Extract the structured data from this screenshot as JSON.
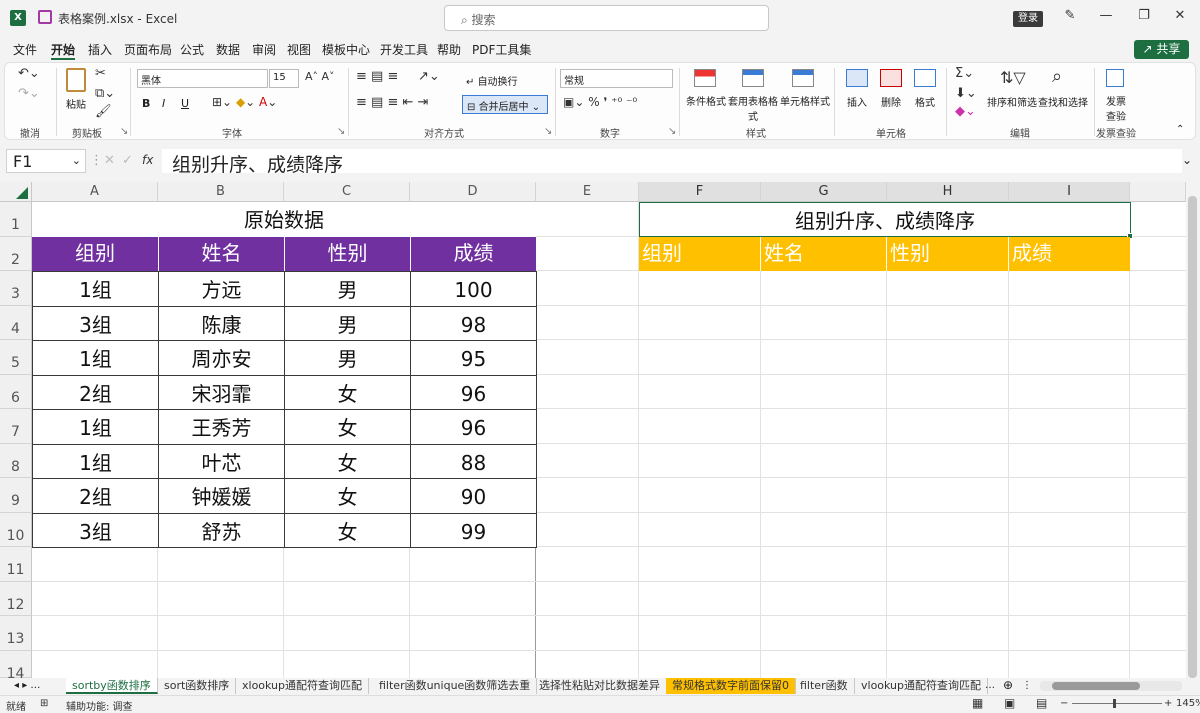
{
  "titlebar": {
    "filename": "表格案例.xlsx",
    "app": "Excel",
    "title": "表格案例.xlsx - Excel",
    "search_placeholder": "搜索",
    "login": "登录"
  },
  "menu": [
    "文件",
    "开始",
    "插入",
    "页面布局",
    "公式",
    "数据",
    "审阅",
    "视图",
    "模板中心",
    "开发工具",
    "帮助",
    "PDF工具集"
  ],
  "share": "共享",
  "ribbon": {
    "undo_group": "撤消",
    "clipboard": {
      "paste": "粘贴",
      "label": "剪贴板"
    },
    "font": {
      "name": "黑体",
      "size": "15",
      "label": "字体",
      "bold": "B",
      "italic": "I",
      "underline": "U"
    },
    "alignment": {
      "wrap": "自动换行",
      "merge": "合并后居中",
      "label": "对齐方式"
    },
    "number": {
      "format": "常规",
      "label": "数字"
    },
    "styles": {
      "conditional": "条件格式",
      "table": "套用表格格式",
      "cell_styles": "单元格样式",
      "label": "样式"
    },
    "cells": {
      "insert": "插入",
      "delete": "删除",
      "format": "格式",
      "label": "单元格"
    },
    "editing": {
      "sort": "排序和筛选",
      "find": "查找和选择",
      "label": "编辑"
    },
    "invoice": {
      "check": "发票查验",
      "label": "发票查验"
    }
  },
  "formula_bar": {
    "name_box": "F1",
    "fx": "fx",
    "content": "组别升序、成绩降序"
  },
  "columns": [
    "A",
    "B",
    "C",
    "D",
    "E",
    "F",
    "G",
    "H",
    "I"
  ],
  "rows": [
    "1",
    "2",
    "3",
    "4",
    "5",
    "6",
    "7",
    "8",
    "9",
    "10",
    "11",
    "12",
    "13",
    "14"
  ],
  "left_table": {
    "title": "原始数据",
    "headers": [
      "组别",
      "姓名",
      "性别",
      "成绩"
    ],
    "rows": [
      [
        "1组",
        "方远",
        "男",
        "100"
      ],
      [
        "3组",
        "陈康",
        "男",
        "98"
      ],
      [
        "1组",
        "周亦安",
        "男",
        "95"
      ],
      [
        "2组",
        "宋羽霏",
        "女",
        "96"
      ],
      [
        "1组",
        "王秀芳",
        "女",
        "96"
      ],
      [
        "1组",
        "叶芯",
        "女",
        "88"
      ],
      [
        "2组",
        "钟媛媛",
        "女",
        "90"
      ],
      [
        "3组",
        "舒苏",
        "女",
        "99"
      ]
    ]
  },
  "right_table": {
    "title": "组别升序、成绩降序",
    "headers": [
      "组别",
      "姓名",
      "性别",
      "成绩"
    ]
  },
  "sheets": [
    "sortby函数排序",
    "sort函数排序",
    "xlookup通配符查询匹配",
    "filter函数unique函数筛选去重",
    "选择性粘贴对比数据差异",
    "常规格式数字前面保留0",
    "filter函数",
    "vlookup通配符查询匹配"
  ],
  "status": {
    "ready": "就绪",
    "accessibility": "辅助功能: 调查",
    "zoom": "145%"
  },
  "colors": {
    "header_purple": "#7030a0",
    "header_yellow": "#ffc000",
    "excel_green": "#1d6f42"
  }
}
